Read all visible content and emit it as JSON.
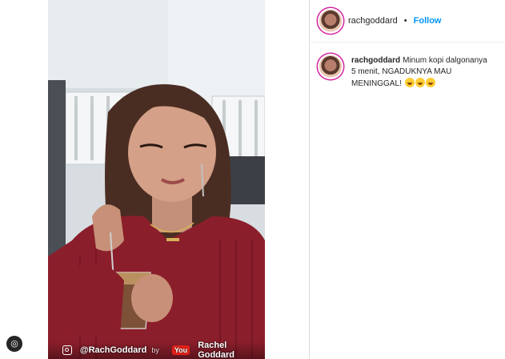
{
  "post": {
    "username": "rachgoddard",
    "separator": "•",
    "follow_label": "Follow"
  },
  "caption": {
    "username": "rachgoddard",
    "text": "Minum kopi dalgonanya 5 menit, NGADUKNYA MAU MENINGGAL!",
    "emojis": [
      "grinning-face-with-sweat",
      "grinning-face-with-sweat",
      "grinning-face-with-sweat"
    ]
  },
  "media": {
    "instagram_handle": "@RachGoddard",
    "by_text": "by",
    "youtube_logo_text": "You",
    "youtube_name": "Rachel Goddard"
  },
  "icons": {
    "left_badge": "instagram-icon"
  },
  "colors": {
    "follow": "#0095f6",
    "sweater": "#8b1e2b",
    "text": "#262626"
  }
}
